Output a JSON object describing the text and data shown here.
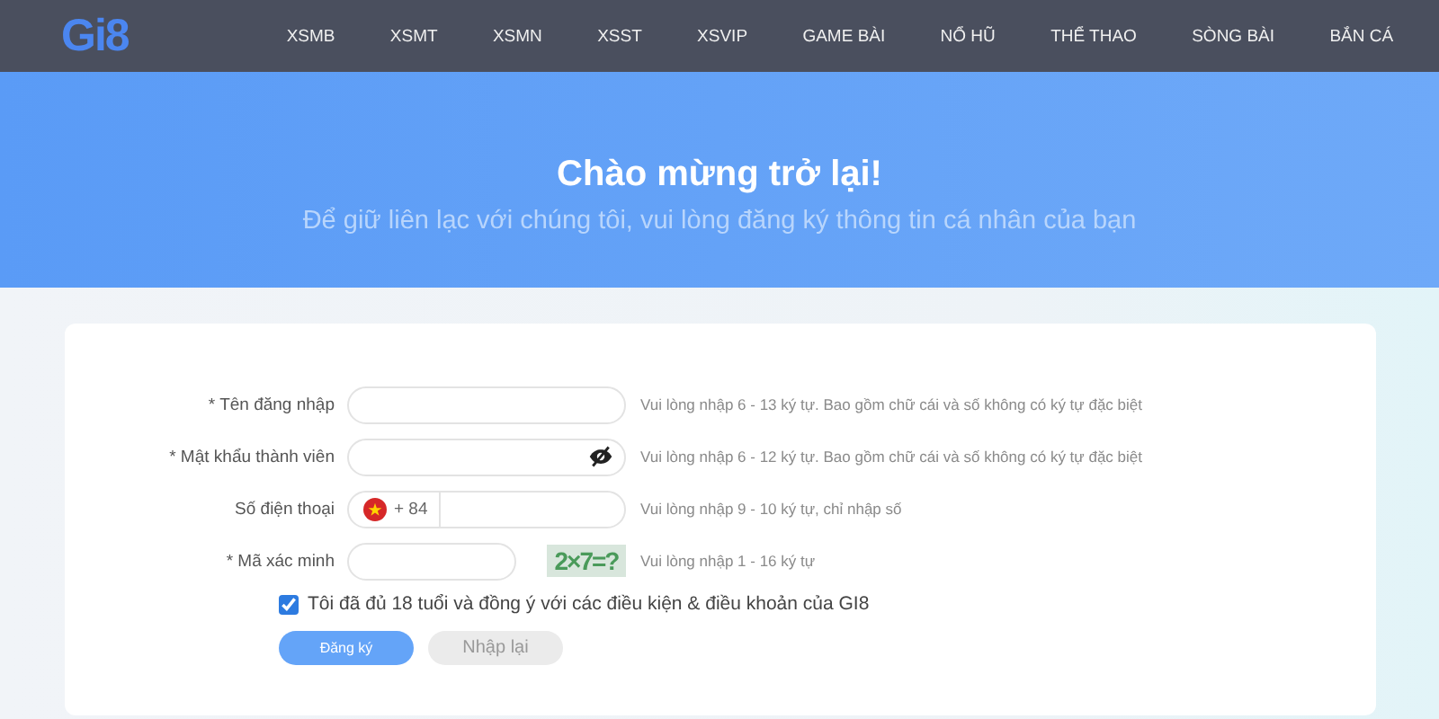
{
  "nav": {
    "logo": "Gi8",
    "items": [
      {
        "label": "XSMB"
      },
      {
        "label": "XSMT"
      },
      {
        "label": "XSMN"
      },
      {
        "label": "XSST"
      },
      {
        "label": "XSVIP"
      },
      {
        "label": "GAME BÀI"
      },
      {
        "label": "NỔ HŨ"
      },
      {
        "label": "THỂ THAO"
      },
      {
        "label": "SÒNG BÀI"
      },
      {
        "label": "BẮN CÁ"
      }
    ]
  },
  "hero": {
    "title": "Chào mừng trở lại!",
    "subtitle": "Để giữ liên lạc với chúng tôi, vui lòng đăng ký thông tin cá nhân của bạn"
  },
  "form": {
    "fields": [
      {
        "kind": "text",
        "label": "* Tên đăng nhập",
        "hint": "Vui lòng nhập 6 - 13 ký tự. Bao gồm chữ cái và số không có ký tự đặc biệt"
      },
      {
        "kind": "password",
        "label": "* Mật khẩu thành viên",
        "hint": "Vui lòng nhập 6 - 12 ký tự. Bao gồm chữ cái và số không có ký tự đặc biệt"
      },
      {
        "kind": "phone",
        "label": "Số điện thoại",
        "prefix": "+ 84",
        "hint": "Vui lòng nhập 9 - 10 ký tự, chỉ nhập số"
      },
      {
        "kind": "captcha",
        "label": "* Mã xác minh",
        "captcha": "2×7=?",
        "hint": "Vui lòng nhập 1 - 16 ký tự"
      }
    ],
    "agree": {
      "checked": true,
      "label": "Tôi đã đủ 18 tuổi và đồng ý với các điều kiện & điều khoản của GI8"
    },
    "buttons": [
      {
        "kind": "primary",
        "label": "Đăng ký"
      },
      {
        "kind": "secondary",
        "label": "Nhập lại"
      }
    ]
  }
}
